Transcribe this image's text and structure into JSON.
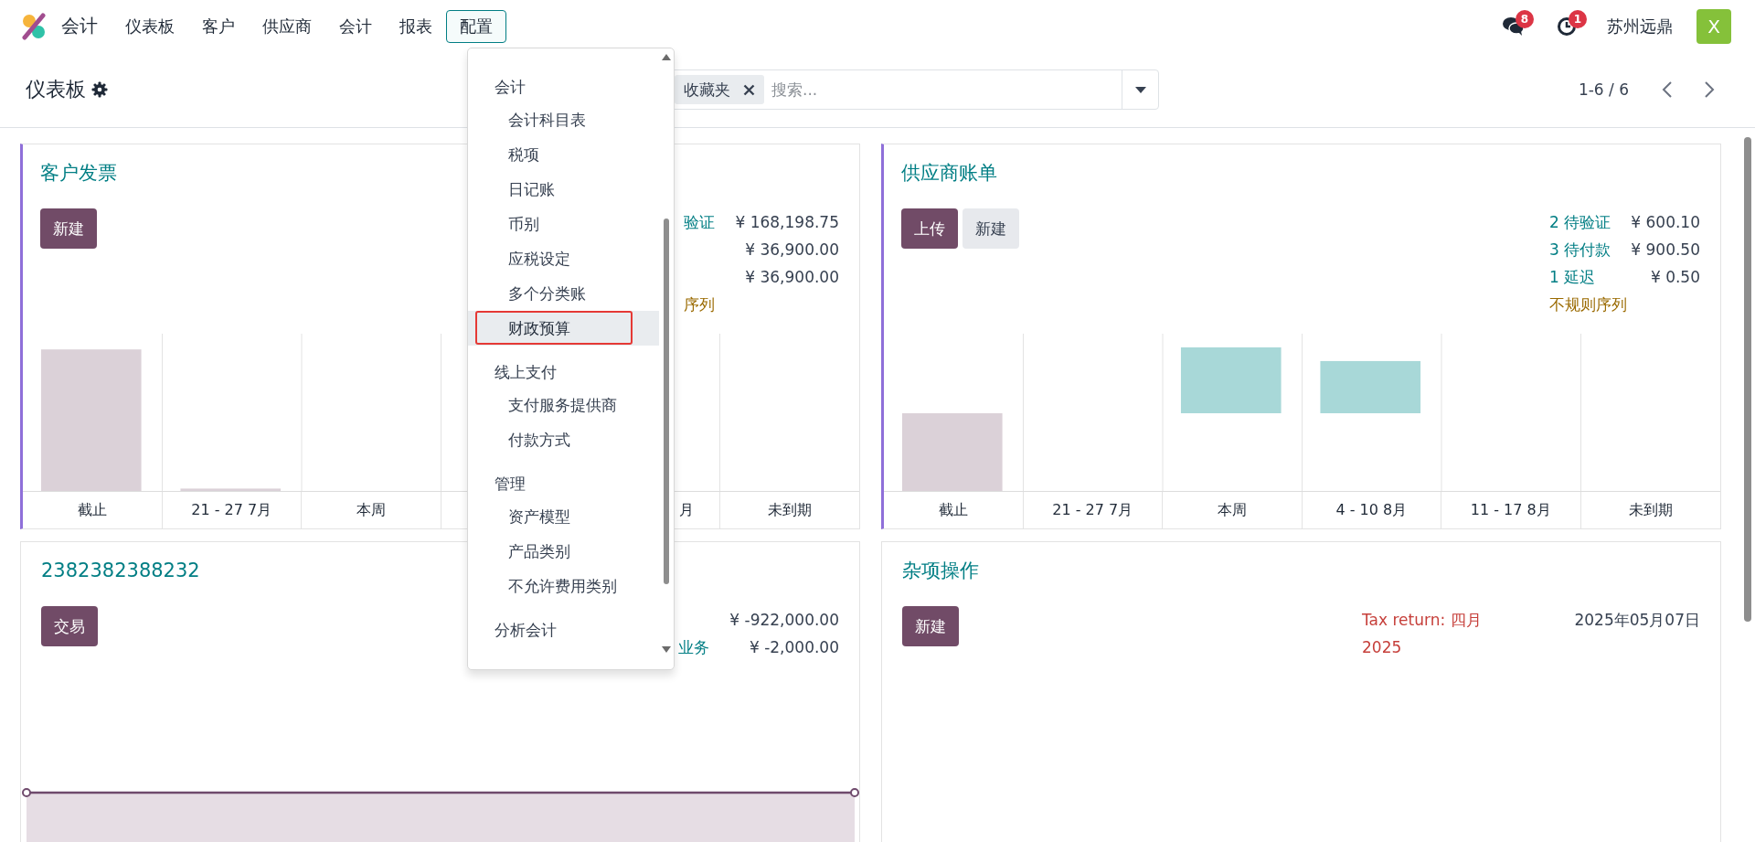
{
  "navbar": {
    "app_name": "会计",
    "menus": [
      {
        "label": "仪表板",
        "selected": false
      },
      {
        "label": "客户",
        "selected": false
      },
      {
        "label": "供应商",
        "selected": false
      },
      {
        "label": "会计",
        "selected": false
      },
      {
        "label": "报表",
        "selected": false
      },
      {
        "label": "配置",
        "selected": true
      }
    ],
    "messages_badge": "8",
    "activities_badge": "1",
    "company": "苏州远鼎",
    "avatar": "X"
  },
  "control_panel": {
    "breadcrumb": "仪表板",
    "facet": "收藏夹",
    "search_placeholder": "搜索...",
    "pager": "1-6 / 6"
  },
  "dropdown": {
    "sections": [
      {
        "header": "会计",
        "items": [
          {
            "label": "会计科目表",
            "selected": false,
            "annotated": false
          },
          {
            "label": "税项",
            "selected": false,
            "annotated": false
          },
          {
            "label": "日记账",
            "selected": false,
            "annotated": false
          },
          {
            "label": "币别",
            "selected": false,
            "annotated": false
          },
          {
            "label": "应税设定",
            "selected": false,
            "annotated": false
          },
          {
            "label": "多个分类账",
            "selected": false,
            "annotated": false
          },
          {
            "label": "财政预算",
            "selected": true,
            "annotated": true
          }
        ]
      },
      {
        "header": "线上支付",
        "items": [
          {
            "label": "支付服务提供商",
            "selected": false,
            "annotated": false
          },
          {
            "label": "付款方式",
            "selected": false,
            "annotated": false
          }
        ]
      },
      {
        "header": "管理",
        "items": [
          {
            "label": "资产模型",
            "selected": false,
            "annotated": false
          },
          {
            "label": "产品类别",
            "selected": false,
            "annotated": false
          },
          {
            "label": "不允许费用类别",
            "selected": false,
            "annotated": false
          }
        ]
      },
      {
        "header": "分析会计"
      }
    ]
  },
  "cards": [
    {
      "title": "客户发票",
      "accent": true,
      "buttons": [
        {
          "label": "新建",
          "kind": "primary"
        }
      ],
      "stats": [
        {
          "label": "验证",
          "kind": "link",
          "amount": "¥ 168,198.75"
        },
        {
          "amount": "¥ 36,900.00"
        },
        {
          "amount": "¥ 36,900.00"
        },
        {
          "label": "序列",
          "kind": "warning"
        }
      ],
      "chart": {
        "kind": "bar",
        "columns": [
          {
            "label": "截止"
          },
          {
            "label": "21 - 27 7月"
          },
          {
            "label": "本周"
          },
          {},
          {
            "label": "月",
            "partial": true
          },
          {
            "label": "未到期"
          }
        ]
      }
    },
    {
      "title": "供应商账单",
      "accent": true,
      "buttons": [
        {
          "label": "上传",
          "kind": "primary"
        },
        {
          "label": "新建",
          "kind": "secondary"
        }
      ],
      "stats": [
        {
          "label": "2 待验证",
          "kind": "link",
          "amount": "¥ 600.10"
        },
        {
          "label": "3 待付款",
          "kind": "link",
          "amount": "¥ 900.50"
        },
        {
          "label": "1 延迟",
          "kind": "link",
          "amount": "¥ 0.50"
        },
        {
          "label": "不规则序列",
          "kind": "warning"
        }
      ],
      "chart": {
        "kind": "bar",
        "columns": [
          {
            "label": "截止"
          },
          {
            "label": "21 - 27 7月"
          },
          {
            "label": "本周"
          },
          {
            "label": "4 - 10 8月"
          },
          {
            "label": "11 - 17 8月"
          },
          {
            "label": "未到期"
          }
        ]
      }
    },
    {
      "title": "2382382388232",
      "accent": false,
      "buttons": [
        {
          "label": "交易",
          "kind": "primary"
        }
      ],
      "stats": [
        {
          "amount": "¥ -922,000.00"
        },
        {
          "label": "业务",
          "kind": "link",
          "amount": "¥ -2,000.00"
        }
      ],
      "chart": {
        "kind": "line"
      }
    },
    {
      "title": "杂项操作",
      "accent": false,
      "buttons": [
        {
          "label": "新建",
          "kind": "primary"
        }
      ],
      "activities": [
        {
          "text": "Tax return: 四月 2025",
          "date": "2025年05月07日"
        }
      ]
    }
  ]
}
